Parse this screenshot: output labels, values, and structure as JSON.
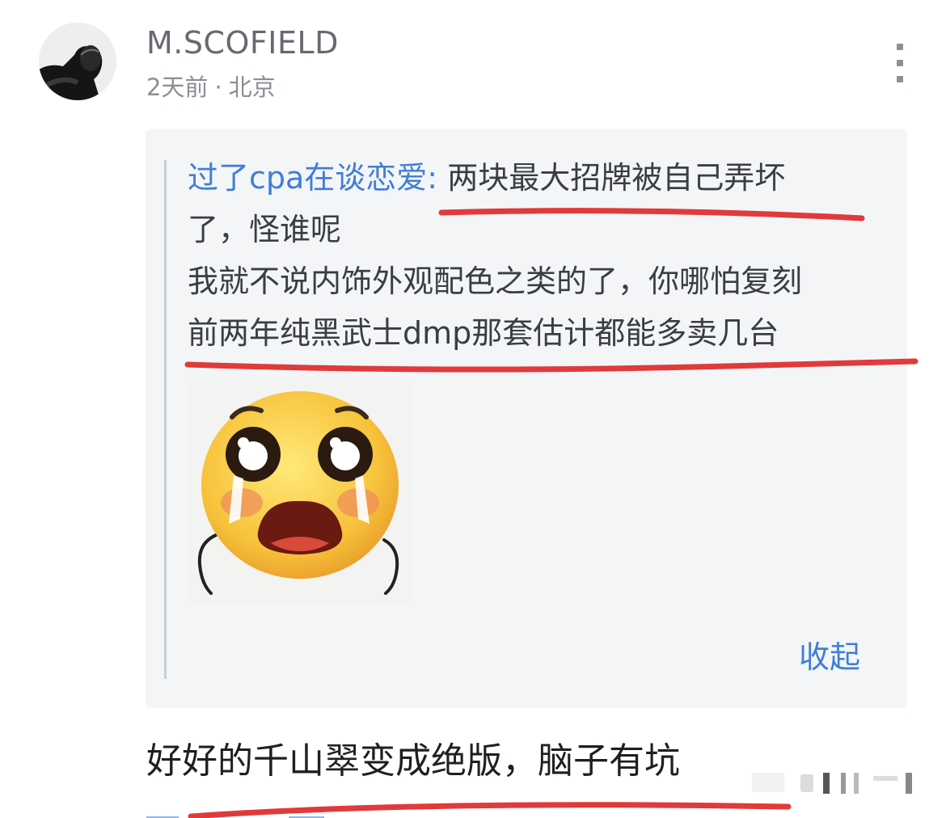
{
  "comment": {
    "username": "M.SCOFIELD",
    "time": "2天前",
    "separator": "·",
    "location": "北京",
    "more_icon": "more-vertical-icon",
    "reply_text": "好好的千山翠变成绝版，脑子有坑"
  },
  "quote": {
    "author": "过了cpa在谈恋爱:",
    "line1_rest": " 两块最大招牌被自己弄坏",
    "line2": "了，怪谁呢",
    "line3": "我就不说内饰外观配色之类的了，你哪怕复刻",
    "line4": "前两年纯黑武士dmp那套估计都能多卖几台",
    "sticker_icon": "crying-emoji-sticker-icon",
    "collapse_label": "收起"
  },
  "colors": {
    "link": "#3f7ed8",
    "annotation_underline": "#e03a3a",
    "quote_background": "#f4f5f7"
  }
}
